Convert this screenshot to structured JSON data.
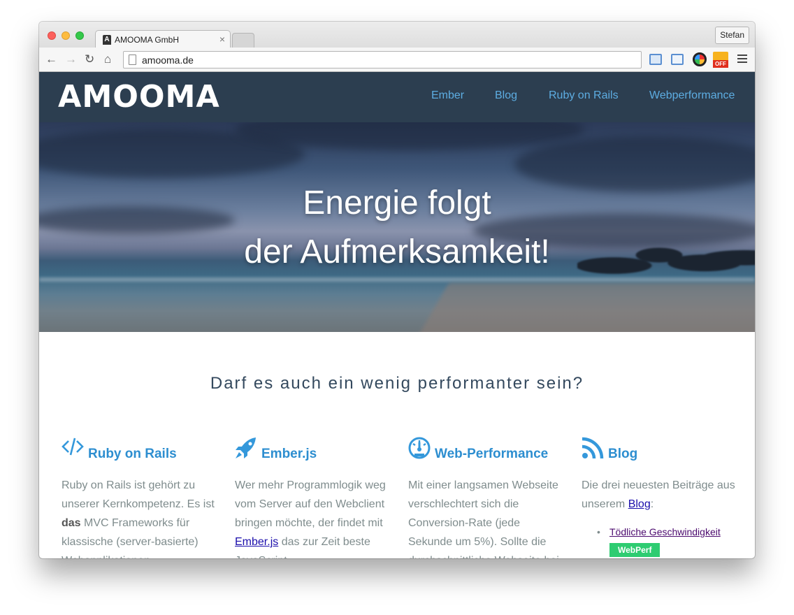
{
  "browser": {
    "tab_title": "AMOOMA GmbH",
    "tab_favicon": "A",
    "tab_close": "×",
    "profile_name": "Stefan",
    "url": "amooma.de",
    "ext_off_label": "OFF",
    "icons": [
      "back-arrow-icon",
      "forward-arrow-icon",
      "reload-icon",
      "home-icon",
      "page-icon",
      "extension-icon",
      "extension-icon",
      "color-picker-icon",
      "webperf-off-icon",
      "menu-icon"
    ]
  },
  "site": {
    "logo": "AMOOMA",
    "nav": [
      "Ember",
      "Blog",
      "Ruby on Rails",
      "Webperformance"
    ],
    "hero": {
      "line1": "Energie folgt",
      "line2": "der Aufmerksamkeit!"
    },
    "tagline": "Darf es auch ein wenig performanter sein?",
    "columns": {
      "rails": {
        "title": "Ruby on Rails",
        "text_1": "Ruby on Rails ist gehört zu unserer Kernkompetenz. Es ist ",
        "text_bold": "das",
        "text_2": " MVC Frameworks für klassische (server-basierte) Webapplikationen"
      },
      "ember": {
        "title": "Ember.js",
        "text_1": "Wer mehr Programmlogik weg vom Server auf den Webclient bringen möchte, der findet mit ",
        "link": "Ember.js",
        "text_2": " das zur Zeit beste JavaScript"
      },
      "webperf": {
        "title": "Web-Performance",
        "text": "Mit einer langsamen Webseite verschlechtert sich die Conversion-Rate (jede Sekunde um 5%). Sollte die durchschnittliche Webseite bei"
      },
      "blog": {
        "title": "Blog",
        "text_1": "Die drei neuesten Beiträge aus unserem ",
        "link": "Blog",
        "text_2": ":",
        "bullet": "•",
        "post_title": "Tödliche Geschwindigkeit",
        "post_tag": "WebPerf"
      }
    }
  },
  "colors": {
    "header_bg": "#2c3e50",
    "nav_link": "#5dade2",
    "accent": "#3498db",
    "tag_green": "#2ecc71"
  }
}
